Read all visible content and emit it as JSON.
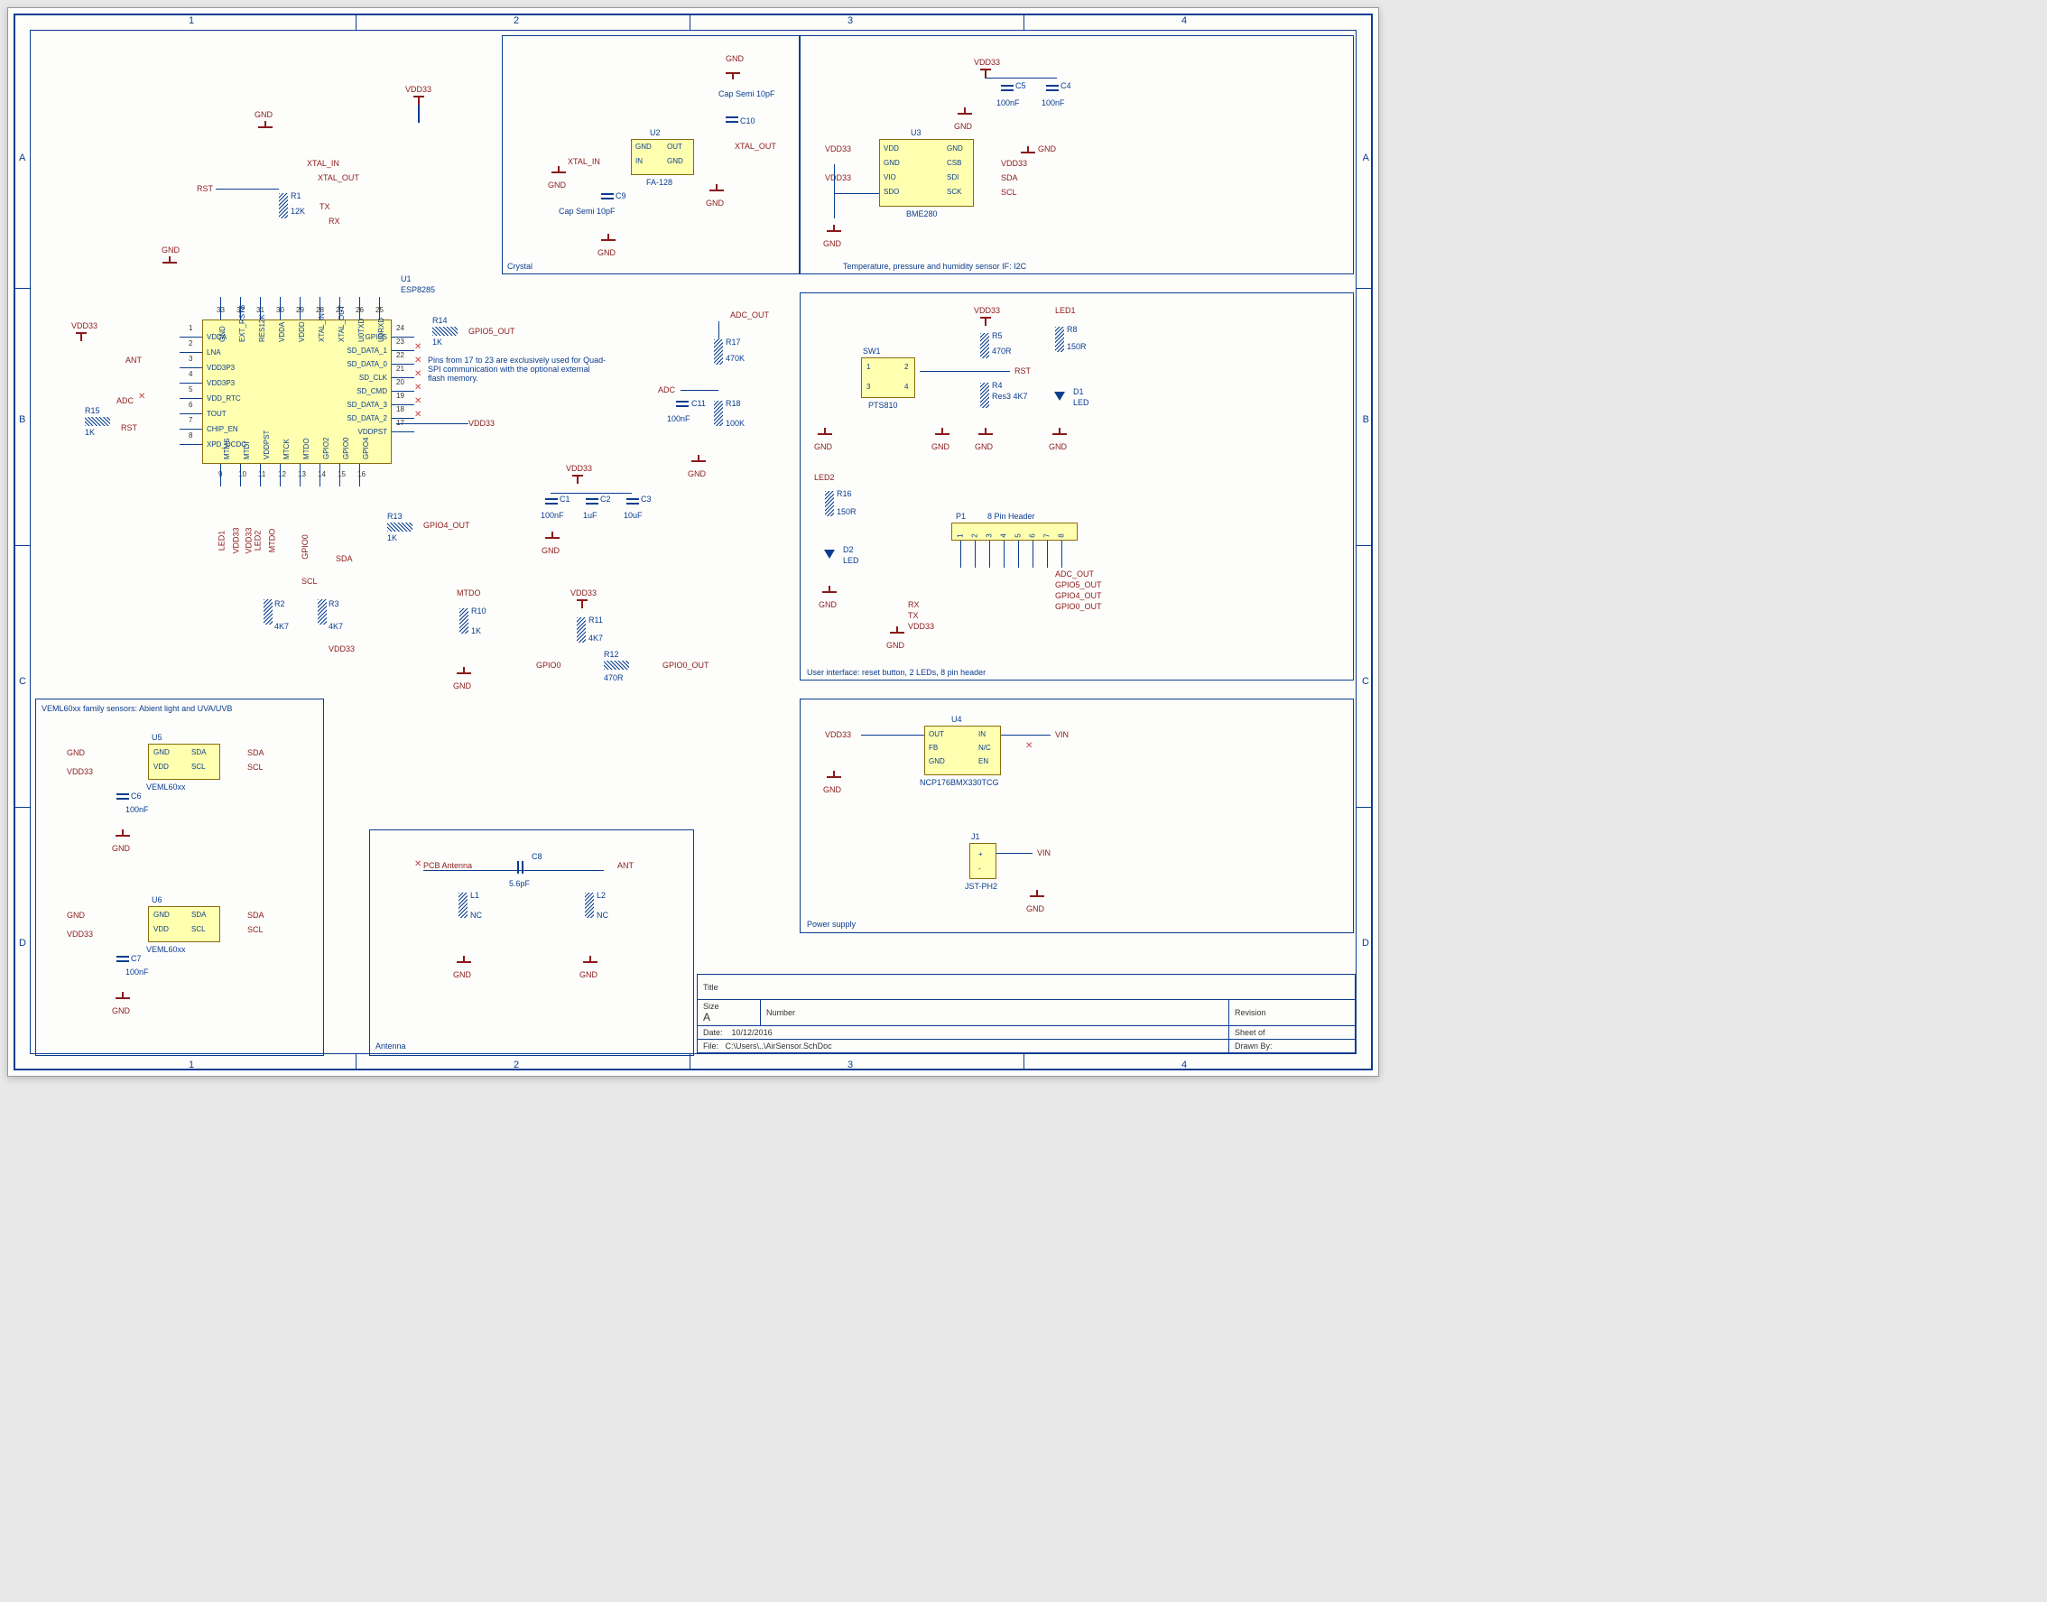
{
  "ruler": {
    "cols": [
      "1",
      "2",
      "3",
      "4"
    ],
    "rows": [
      "A",
      "B",
      "C",
      "D"
    ]
  },
  "main_chip": {
    "ref": "U1",
    "part": "ESP8285",
    "left_pins": [
      [
        "1",
        "VDDA"
      ],
      [
        "2",
        "LNA"
      ],
      [
        "3",
        "VDD3P3"
      ],
      [
        "4",
        "VDD3P3"
      ],
      [
        "5",
        "VDD_RTC"
      ],
      [
        "6",
        "TOUT"
      ],
      [
        "7",
        "CHIP_EN"
      ],
      [
        "8",
        "XPD_DCDC"
      ]
    ],
    "right_pins": [
      [
        "24",
        "GPIO5"
      ],
      [
        "23",
        "SD_DATA_1"
      ],
      [
        "22",
        "SD_DATA_0"
      ],
      [
        "21",
        "SD_CLK"
      ],
      [
        "20",
        "SD_CMD"
      ],
      [
        "19",
        "SD_DATA_3"
      ],
      [
        "18",
        "SD_DATA_2"
      ],
      [
        "17",
        "VDDPST"
      ]
    ],
    "top_pins": [
      [
        "33",
        "GND"
      ],
      [
        "32",
        "EXT_RSTB"
      ],
      [
        "31",
        "RES12K"
      ],
      [
        "30",
        "VDDA"
      ],
      [
        "29",
        "VDDD"
      ],
      [
        "28",
        "XTAL_IN"
      ],
      [
        "27",
        "XTAL_OUT"
      ],
      [
        "26",
        "U0TXD"
      ],
      [
        "25",
        "U0RXD"
      ]
    ],
    "bot_pins": [
      [
        "9",
        "MTMS"
      ],
      [
        "10",
        "MTDI"
      ],
      [
        "11",
        "VDDPST"
      ],
      [
        "12",
        "MTCK"
      ],
      [
        "13",
        "MTDO"
      ],
      [
        "14",
        "GPIO2"
      ],
      [
        "15",
        "GPIO0"
      ],
      [
        "16",
        "GPIO4"
      ]
    ],
    "note": "Pins from 17 to 23 are exclusively used for Quad-SPI communication with the optional external flash memory."
  },
  "crystal": {
    "title": "Crystal",
    "chip": "FA-128",
    "ref": "U2",
    "pins": [
      "GND",
      "IN",
      "OUT",
      "GND"
    ],
    "c9": {
      "ref": "C9",
      "val": "Cap Semi 10pF"
    },
    "c10": {
      "ref": "C10",
      "val": "Cap Semi 10pF"
    },
    "nets": [
      "XTAL_IN",
      "XTAL_OUT",
      "GND"
    ]
  },
  "bme": {
    "title": "Temperature, pressure and humidity sensor IF: I2C",
    "ref": "U3",
    "part": "BME280",
    "pins": [
      "VDD",
      "GND",
      "VIO",
      "SDO",
      "GND",
      "CSB",
      "SDI",
      "SCK"
    ],
    "c4": {
      "ref": "C4",
      "val": "100nF"
    },
    "c5": {
      "ref": "C5",
      "val": "100nF"
    },
    "nets": [
      "VDD33",
      "SDA",
      "SCL",
      "GND"
    ]
  },
  "adc": {
    "r17": {
      "ref": "R17",
      "val": "470K"
    },
    "r18": {
      "ref": "R18",
      "val": "100K"
    },
    "c11": {
      "ref": "C11",
      "val": "100nF"
    },
    "nets": [
      "ADC_OUT",
      "ADC",
      "GND"
    ]
  },
  "decoup": {
    "c1": {
      "ref": "C1",
      "val": "100nF"
    },
    "c2": {
      "ref": "C2",
      "val": "1uF"
    },
    "c3": {
      "ref": "C3",
      "val": "10uF"
    },
    "net": "VDD33"
  },
  "r14": {
    "ref": "R14",
    "val": "1K",
    "net": "GPIO5_OUT"
  },
  "r13": {
    "ref": "R13",
    "val": "1K",
    "net": "GPIO4_OUT"
  },
  "r10": {
    "ref": "R10",
    "val": "1K",
    "net": "MTDO"
  },
  "r11": {
    "ref": "R11",
    "val": "4K7"
  },
  "r12": {
    "ref": "R12",
    "val": "470R",
    "net": "GPIO0_OUT"
  },
  "r1": {
    "ref": "R1",
    "val": "12K"
  },
  "r2": {
    "ref": "R2",
    "val": "4K7"
  },
  "r3": {
    "ref": "R3",
    "val": "4K7"
  },
  "r15": {
    "ref": "R15",
    "val": "1K"
  },
  "nets_main": [
    "VDD33",
    "GND",
    "RST",
    "XTAL_IN",
    "XTAL_OUT",
    "TX",
    "RX",
    "ANT",
    "ADC",
    "SDA",
    "SCL",
    "LED1",
    "LED2",
    "MTDO",
    "GPIO0",
    "VDD33"
  ],
  "ui": {
    "title": "User interface: reset button, 2 LEDs, 8 pin header",
    "sw": {
      "ref": "SW1",
      "part": "PTS810",
      "pins": [
        "1",
        "2",
        "3",
        "4"
      ]
    },
    "r5": {
      "ref": "R5",
      "val": "470R"
    },
    "r4": {
      "ref": "R4",
      "val": "Res3 4K7"
    },
    "r8": {
      "ref": "R8",
      "val": "150R"
    },
    "r16": {
      "ref": "R16",
      "val": "150R"
    },
    "led1": {
      "ref": "LED1",
      "d": "D1",
      "type": "LED"
    },
    "led2": {
      "ref": "LED2",
      "d": "D2",
      "type": "LED"
    },
    "header": {
      "ref": "P1",
      "title": "8 Pin Header",
      "pins": [
        "1",
        "2",
        "3",
        "4",
        "5",
        "6",
        "7",
        "8"
      ],
      "nets": [
        "GND",
        "RX",
        "TX",
        "VDD33",
        "ADC_OUT",
        "GPIO5_OUT",
        "GPIO4_OUT",
        "GPIO0_OUT"
      ]
    },
    "rst_net": "RST",
    "vdd": "VDD33"
  },
  "veml": {
    "title": "VEML60xx family sensors: Abient light and UVA/UVB",
    "u5": {
      "ref": "U5",
      "part": "VEML60xx",
      "pins": [
        "GND",
        "VDD",
        "SDA",
        "SCL"
      ]
    },
    "u6": {
      "ref": "U6",
      "part": "VEML60xx",
      "pins": [
        "GND",
        "VDD",
        "SDA",
        "SCL"
      ]
    },
    "c6": {
      "ref": "C6",
      "val": "100nF"
    },
    "c7": {
      "ref": "C7",
      "val": "100nF"
    },
    "nets": [
      "GND",
      "VDD33",
      "SDA",
      "SCL"
    ]
  },
  "antenna": {
    "title": "Antenna",
    "pcb": "PCB Antenna",
    "c8": {
      "ref": "C8",
      "val": "5.6pF"
    },
    "l1": {
      "ref": "L1",
      "val": "NC"
    },
    "l2": {
      "ref": "L2",
      "val": "NC"
    },
    "net": "ANT"
  },
  "psu": {
    "title": "Power supply",
    "u4": {
      "ref": "U4",
      "part": "NCP176BMX330TCG",
      "pins": [
        "OUT",
        "FB",
        "GND",
        "IN",
        "N/C",
        "EN"
      ]
    },
    "j1": {
      "ref": "J1",
      "part": "JST-PH2",
      "pins": [
        "+",
        "-"
      ]
    },
    "nets": [
      "VDD33",
      "VIN",
      "GND"
    ]
  },
  "titleblock": {
    "title_label": "Title",
    "size_label": "Size",
    "size": "A",
    "number_label": "Number",
    "revision_label": "Revision",
    "date_label": "Date:",
    "date": "10/12/2016",
    "sheet_label": "Sheet    of",
    "file_label": "File:",
    "file": "C:\\Users\\..\\AirSensor.SchDoc",
    "drawn_label": "Drawn By:"
  }
}
